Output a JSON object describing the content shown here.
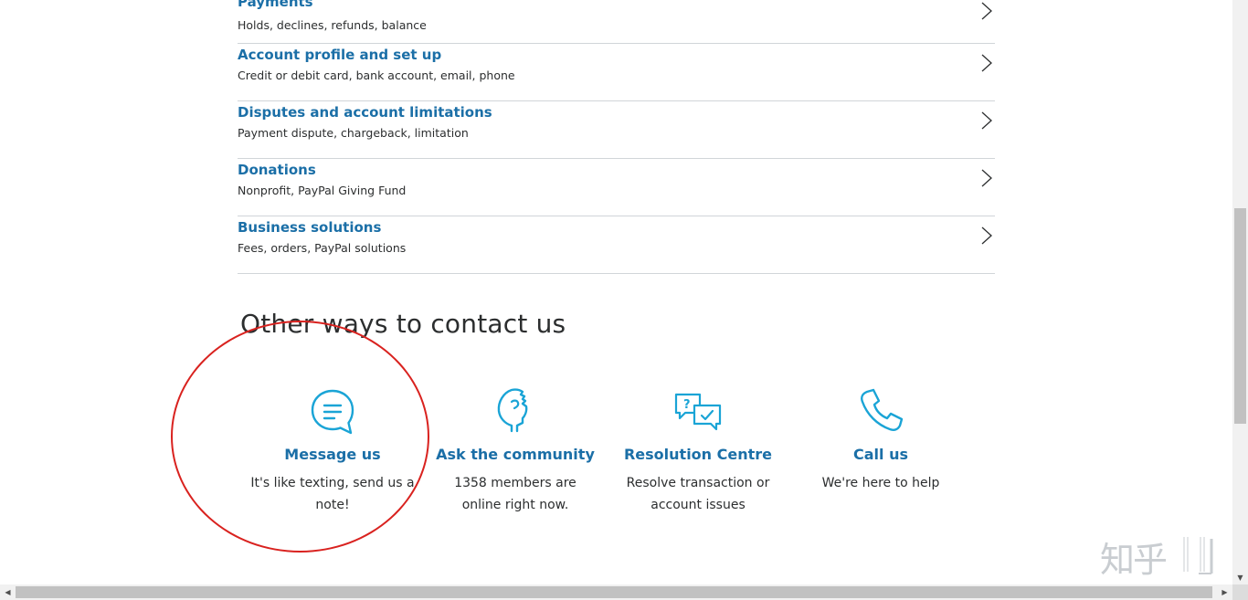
{
  "topics": [
    {
      "title": "Payments",
      "subtitle": "Holds, declines, refunds, balance"
    },
    {
      "title": "Account profile and set up",
      "subtitle": "Credit or debit card, bank account, email, phone"
    },
    {
      "title": "Disputes and account limitations",
      "subtitle": "Payment dispute, chargeback, limitation"
    },
    {
      "title": "Donations",
      "subtitle": "Nonprofit, PayPal Giving Fund"
    },
    {
      "title": "Business solutions",
      "subtitle": "Fees, orders, PayPal solutions"
    }
  ],
  "contact": {
    "heading": "Other ways to contact us",
    "options": [
      {
        "title": "Message us",
        "description": "It's like texting, send us a note!",
        "icon": "message-bubble-icon"
      },
      {
        "title": "Ask the community",
        "description": "1358 members are online right now.",
        "icon": "community-head-icon"
      },
      {
        "title": "Resolution Centre",
        "description": "Resolve transaction or account issues",
        "icon": "resolution-chat-icon"
      },
      {
        "title": "Call us",
        "description": "We're here to help",
        "icon": "phone-icon"
      }
    ]
  },
  "watermark": {
    "text": "知乎"
  },
  "colors": {
    "link": "#1b6fa7",
    "icon": "#1aa4d6",
    "text": "#2c2e2f",
    "divider": "#d1d5d9",
    "annotation": "#d9221f"
  }
}
